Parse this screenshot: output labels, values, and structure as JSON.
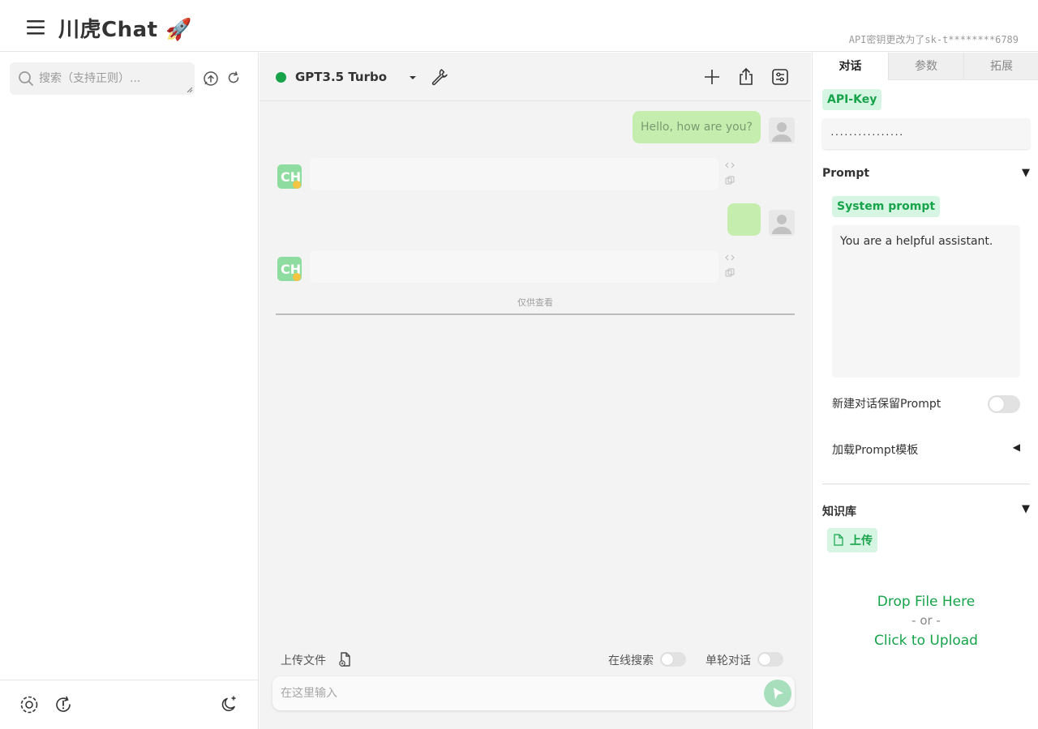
{
  "header": {
    "title": "川虎Chat 🚀",
    "api_status": "API密钥更改为了sk-t********6789"
  },
  "sidebar": {
    "search_placeholder": "搜索（支持正则）...",
    "icons": [
      "upload-history-icon",
      "refresh-icon"
    ],
    "footer_icons": [
      "settings-icon",
      "update-icon",
      "dark-mode-icon"
    ]
  },
  "toolbar": {
    "model": "GPT3.5 Turbo",
    "model_status_color": "#16a34a",
    "icons": [
      "wrench-icon",
      "new-chat-icon",
      "share-icon",
      "options-icon"
    ]
  },
  "chat": {
    "messages": [
      {
        "role": "user",
        "text": "Hello, how are you?"
      },
      {
        "role": "bot",
        "text": ""
      },
      {
        "role": "user",
        "text": ""
      },
      {
        "role": "bot",
        "text": ""
      }
    ],
    "divider_label": "仅供查看"
  },
  "input": {
    "upload_label": "上传文件",
    "online_search_label": "在线搜索",
    "online_search_on": false,
    "single_turn_label": "单轮对话",
    "single_turn_on": false,
    "placeholder": "在这里输入"
  },
  "right_panel": {
    "tabs": [
      "对话",
      "参数",
      "拓展"
    ],
    "active_tab": "对话",
    "api_key_label": "API-Key",
    "api_key_value": "················",
    "prompt_section": "Prompt",
    "system_prompt_label": "System prompt",
    "system_prompt_value": "You are a helpful assistant.",
    "keep_prompt_label": "新建对话保留Prompt",
    "keep_prompt_on": false,
    "load_template_label": "加载Prompt模板",
    "kb_section": "知识库",
    "upload_label": "上传",
    "drop_file": "Drop File Here",
    "or": "- or -",
    "click_upload": "Click to Upload",
    "accent_color": "#16a34a"
  }
}
